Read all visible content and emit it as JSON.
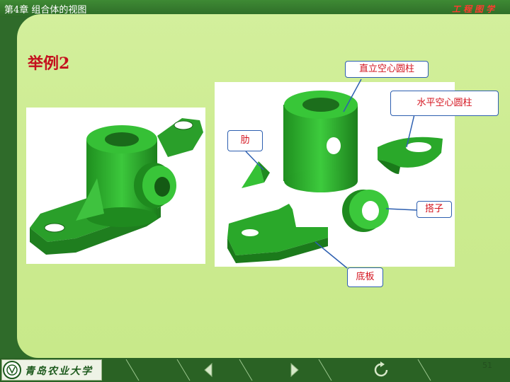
{
  "header": {
    "chapter_title": "第4章  组合体的视图",
    "course_title": "工程图学"
  },
  "slide": {
    "heading": "举例2",
    "page_number": "51"
  },
  "callouts": {
    "vertical_hollow_cylinder": "直立空心圆柱",
    "horizontal_hollow_cylinder": "水平空心圆柱",
    "rib": "肋",
    "boss": "搭子",
    "base_plate": "底板"
  },
  "footer": {
    "logo_text": "青岛农业大学",
    "nav": [
      {
        "icon": "previous-icon"
      },
      {
        "icon": "next-icon"
      },
      {
        "icon": "return-icon"
      }
    ]
  },
  "colors": {
    "part_green": "#2fb52f",
    "callout_text": "#d4141f",
    "callout_border": "#2d5fb0",
    "heading": "#c4101e",
    "panel": "#cdec92"
  }
}
